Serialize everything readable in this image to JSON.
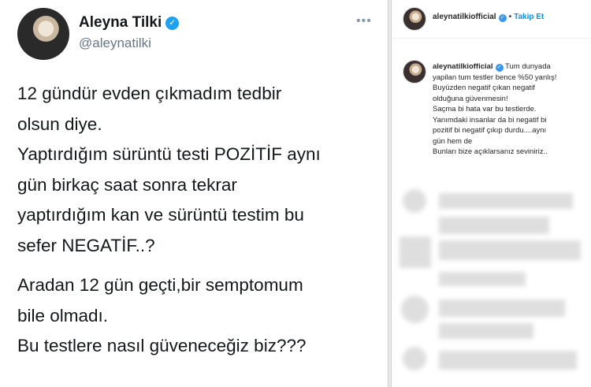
{
  "tweet": {
    "name": "Aleyna Tilki",
    "handle": "@aleynatilki",
    "more_label": "•••",
    "paragraph1": [
      "12 gündür evden çıkmadım tedbir",
      "olsun diye.",
      "Yaptırdığım sürüntü testi POZİTİF aynı",
      "gün birkaç saat sonra tekrar",
      "yaptırdığım kan ve sürüntü testim bu",
      "sefer NEGATİF..?"
    ],
    "paragraph2": [
      "Aradan 12 gün geçti,bir semptomum",
      "bile olmadı.",
      "Bu testlere nasıl güveneceğiz biz???"
    ]
  },
  "instagram": {
    "username": "aleynatilkiofficial",
    "separator": "•",
    "follow_label": "Takip Et",
    "caption_lines": [
      "Tum dunyada",
      "yapilan tum testler bence %50 yanlış!",
      "Buyüzden negatif çıkan negatif",
      "olduğuna güvenmesin!",
      "Saçma bi hata var bu testlerde.",
      "Yanımdaki insanlar da bi negatif bi",
      "pozitif bi negatif çıkıp durdu....aynı",
      "gün hem de",
      "Bunları bize açıklarsanız seviniriz.."
    ]
  },
  "colors": {
    "twitter_blue": "#1da1f2",
    "instagram_blue": "#0095f6",
    "text_dark": "#14171a",
    "text_gray": "#657786"
  },
  "icons": [
    "verified-badge-icon",
    "more-options-icon"
  ]
}
